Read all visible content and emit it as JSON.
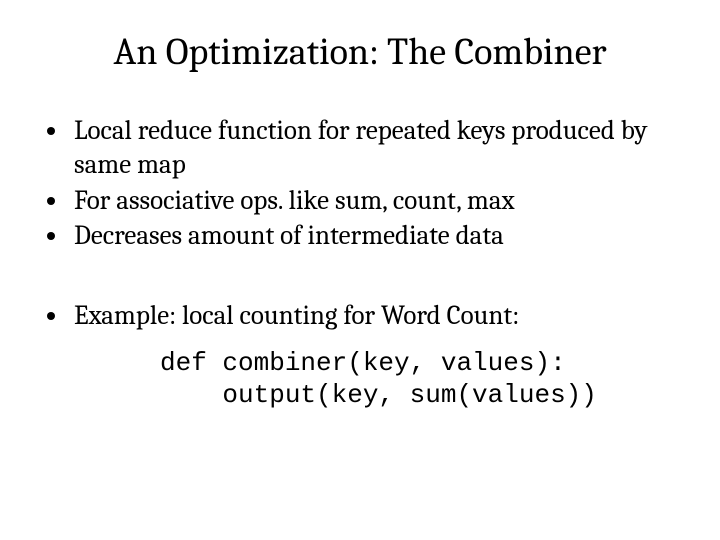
{
  "title": "An Optimization: The Combiner",
  "bullets_a": [
    "Local reduce function for repeated keys produced by same map",
    "For associative ops. like sum, count, max",
    "Decreases amount of intermediate data"
  ],
  "bullets_b": [
    "Example: local counting for Word Count:"
  ],
  "code": {
    "line1": "def combiner(key, values):",
    "line2": "    output(key, sum(values))"
  }
}
